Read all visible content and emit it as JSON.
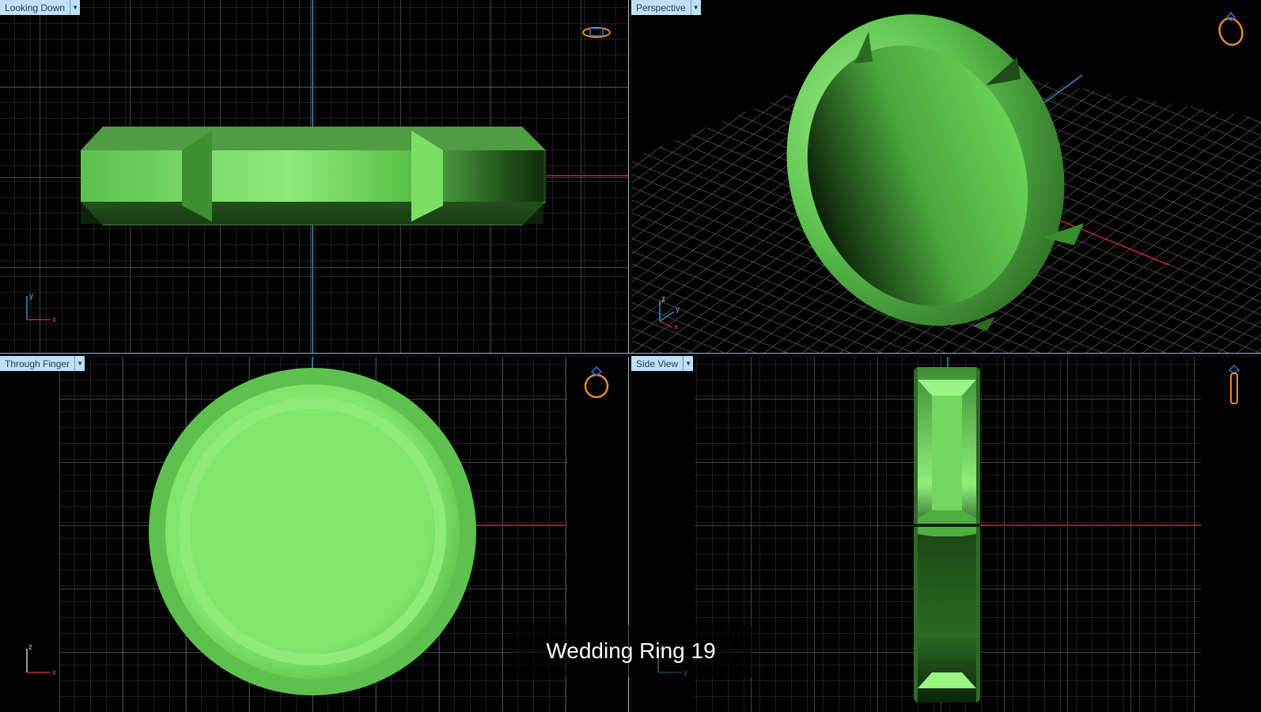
{
  "viewports": {
    "top_left": {
      "label": "Looking Down",
      "view_icon": "ring-top-view-icon"
    },
    "top_right": {
      "label": "Perspective",
      "view_icon": "ring-perspective-view-icon"
    },
    "bottom_left": {
      "label": "Through Finger",
      "view_icon": "ring-front-view-icon"
    },
    "bottom_right": {
      "label": "Side View",
      "view_icon": "ring-side-view-icon"
    }
  },
  "axes": {
    "top_left": [
      "y",
      "x"
    ],
    "top_right": [
      "z",
      "y",
      "x"
    ],
    "bottom_left": [
      "z",
      "x"
    ],
    "bottom_right": [
      "z",
      "y"
    ]
  },
  "caption": "Wedding Ring 19",
  "colors": {
    "ring": "#6fdc5c",
    "grid": "#5a5a5a",
    "axis_x": "#c62828",
    "axis_y": "#2f8fc8",
    "tab_bg": "#bfe0f5",
    "icon": "#e58a2a"
  }
}
